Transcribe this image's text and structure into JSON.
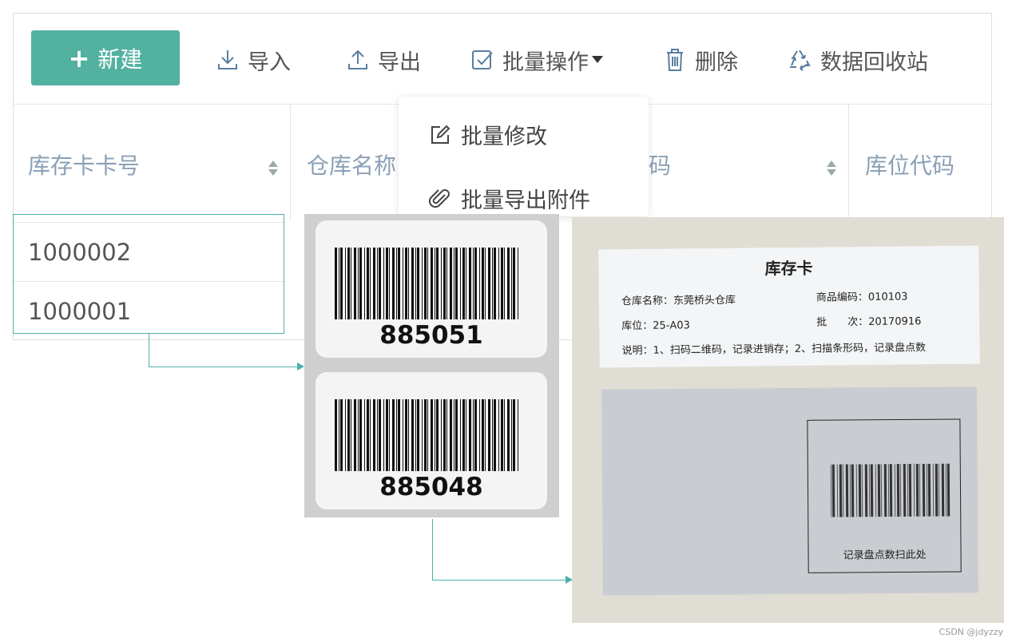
{
  "toolbar": {
    "new_label": "新建",
    "new_plus": "+",
    "import_label": "导入",
    "export_label": "导出",
    "batch_label": "批量操作",
    "delete_label": "删除",
    "recycle_label": "数据回收站"
  },
  "table": {
    "headers": [
      "库存卡卡号",
      "仓库名称",
      "码",
      "库位代码"
    ],
    "rows": [
      "1000002",
      "1000001"
    ]
  },
  "dropdown": {
    "items": [
      "批量修改",
      "批量导出附件"
    ]
  },
  "barcodes": [
    "885051",
    "885048"
  ],
  "inventory_card": {
    "title": "库存卡",
    "warehouse": "仓库名称：东莞桥头仓库",
    "product_code": "商品编码：010103",
    "location": "库位：25-A03",
    "batch": "批　　次：20170916",
    "note": "说明：1、扫码二维码，记录进销存；2、扫描条形码，记录盘点数",
    "scan_label": "记录盘点数扫此处"
  },
  "watermark": "CSDN @jdyzzy",
  "colors": {
    "accent": "#53b1a0",
    "connector": "#4cb0a9",
    "header_text": "#8aa0b6"
  },
  "icons": [
    "plus-icon",
    "download-icon",
    "upload-icon",
    "checkbox-icon",
    "caret-down-icon",
    "trash-icon",
    "recycle-icon",
    "edit-icon",
    "paperclip-icon"
  ]
}
